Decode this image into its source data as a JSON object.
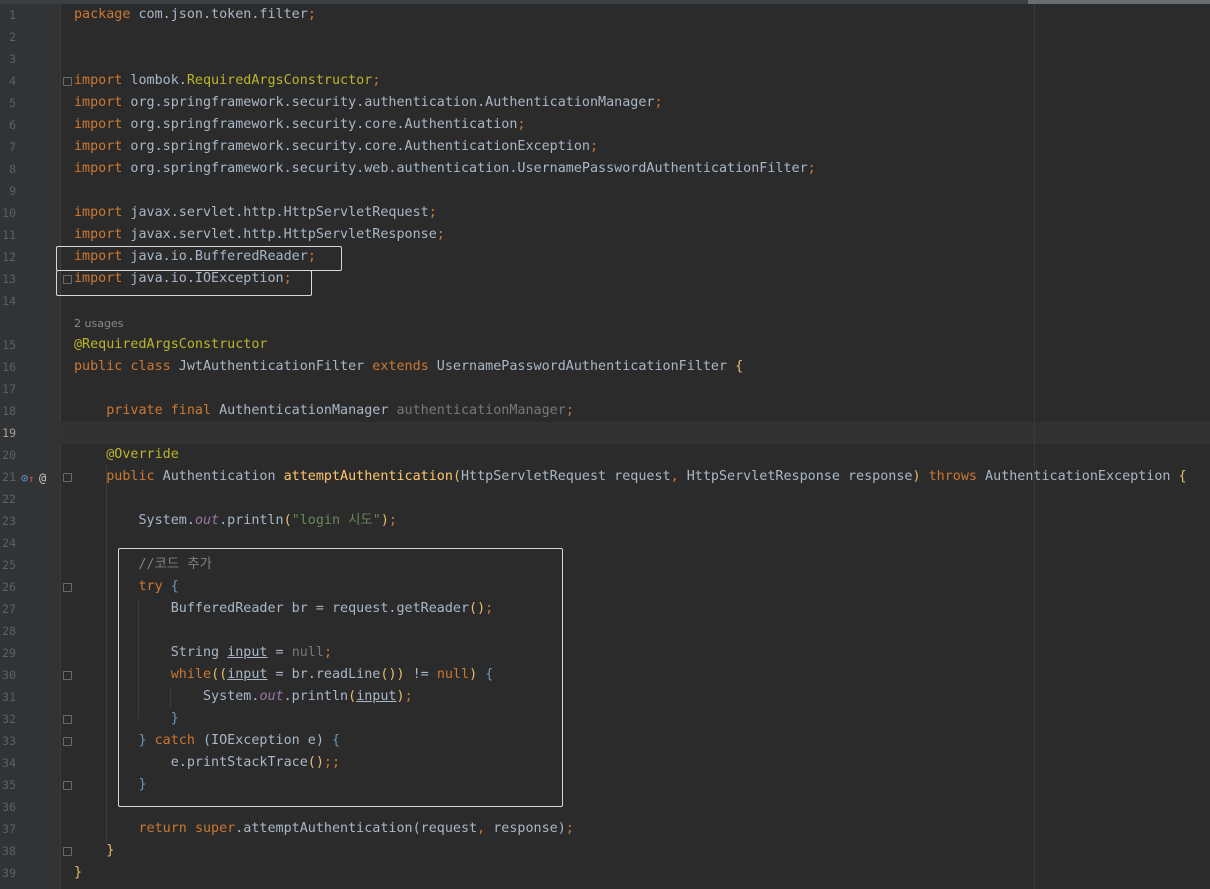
{
  "editor": {
    "usages_hint": "2 usages",
    "gutter_icons": [
      "implements-method-icon",
      "override-at-icon"
    ],
    "lines": [
      {
        "n": "1",
        "code": "package com.json.token.filter;"
      },
      {
        "n": "2",
        "code": ""
      },
      {
        "n": "3",
        "code": ""
      },
      {
        "n": "4",
        "code": "import lombok.RequiredArgsConstructor;"
      },
      {
        "n": "5",
        "code": "import org.springframework.security.authentication.AuthenticationManager;"
      },
      {
        "n": "6",
        "code": "import org.springframework.security.core.Authentication;"
      },
      {
        "n": "7",
        "code": "import org.springframework.security.core.AuthenticationException;"
      },
      {
        "n": "8",
        "code": "import org.springframework.security.web.authentication.UsernamePasswordAuthenticationFilter;"
      },
      {
        "n": "9",
        "code": ""
      },
      {
        "n": "10",
        "code": "import javax.servlet.http.HttpServletRequest;"
      },
      {
        "n": "11",
        "code": "import javax.servlet.http.HttpServletResponse;"
      },
      {
        "n": "12",
        "code": "import java.io.BufferedReader;"
      },
      {
        "n": "13",
        "code": "import java.io.IOException;"
      },
      {
        "n": "14",
        "code": ""
      },
      {
        "n": "15",
        "code": "@RequiredArgsConstructor"
      },
      {
        "n": "16",
        "code": "public class JwtAuthenticationFilter extends UsernamePasswordAuthenticationFilter {"
      },
      {
        "n": "17",
        "code": ""
      },
      {
        "n": "18",
        "code": "    private final AuthenticationManager authenticationManager;"
      },
      {
        "n": "19",
        "code": ""
      },
      {
        "n": "20",
        "code": "    @Override"
      },
      {
        "n": "21",
        "code": "    public Authentication attemptAuthentication(HttpServletRequest request, HttpServletResponse response) throws AuthenticationException {"
      },
      {
        "n": "22",
        "code": ""
      },
      {
        "n": "23",
        "code": "        System.out.println(\"login 시도\");"
      },
      {
        "n": "24",
        "code": ""
      },
      {
        "n": "25",
        "code": "        //코드 추가"
      },
      {
        "n": "26",
        "code": "        try {"
      },
      {
        "n": "27",
        "code": "            BufferedReader br = request.getReader();"
      },
      {
        "n": "28",
        "code": ""
      },
      {
        "n": "29",
        "code": "            String input = null;"
      },
      {
        "n": "30",
        "code": "            while((input = br.readLine()) != null) {"
      },
      {
        "n": "31",
        "code": "                System.out.println(input);"
      },
      {
        "n": "32",
        "code": "            }"
      },
      {
        "n": "33",
        "code": "        } catch (IOException e) {"
      },
      {
        "n": "34",
        "code": "            e.printStackTrace();;"
      },
      {
        "n": "35",
        "code": "        }"
      },
      {
        "n": "36",
        "code": ""
      },
      {
        "n": "37",
        "code": "        return super.attemptAuthentication(request, response);"
      },
      {
        "n": "38",
        "code": "    }"
      },
      {
        "n": "39",
        "code": "}"
      }
    ],
    "colors": {
      "background": "#2b2b2b",
      "gutter": "#313335",
      "keyword": "#cc7832",
      "annotation": "#bbb529",
      "string": "#6a8759",
      "comment": "#808080",
      "method_decl": "#ffc66d",
      "field": "#9876aa",
      "default_text": "#a9b7c6",
      "highlight_box": "#d8d8d8"
    }
  }
}
